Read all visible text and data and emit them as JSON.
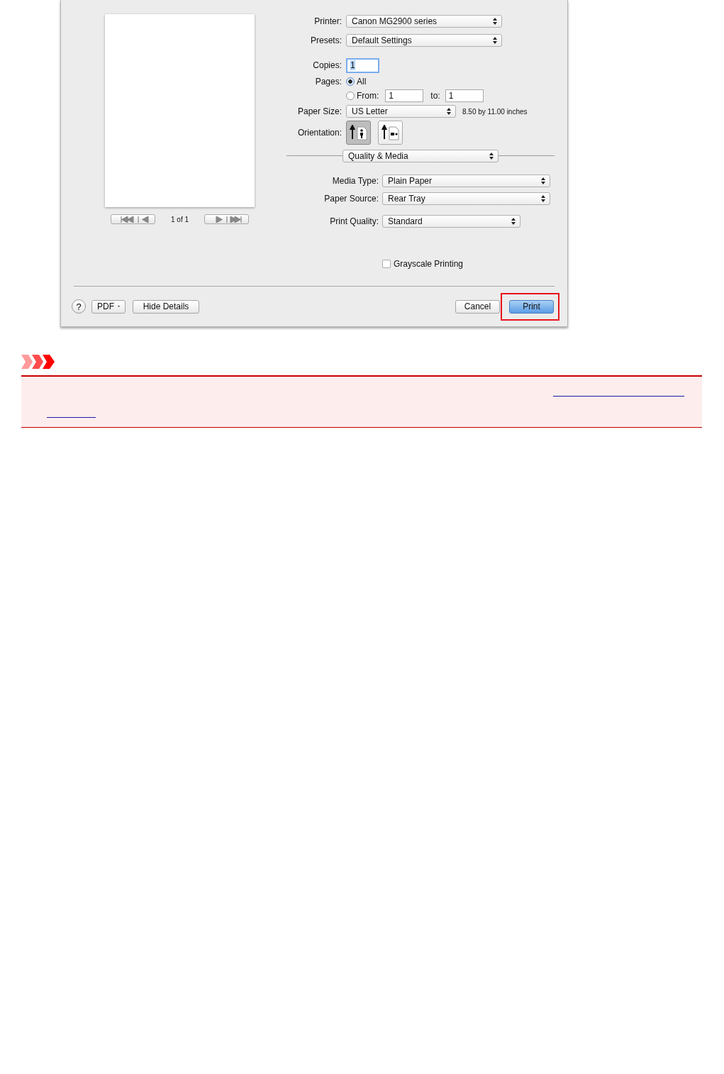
{
  "preview": {
    "page_indicator": "1 of 1"
  },
  "printer": {
    "label": "Printer:",
    "value": "Canon MG2900 series"
  },
  "presets": {
    "label": "Presets:",
    "value": "Default Settings"
  },
  "copies": {
    "label": "Copies:",
    "value": "1"
  },
  "pages": {
    "label": "Pages:",
    "options": [
      {
        "label": "All",
        "selected": true
      },
      {
        "label": "From:",
        "selected": false
      }
    ],
    "from": "1",
    "to_label": "to:",
    "to": "1"
  },
  "paper_size": {
    "label": "Paper Size:",
    "value": "US Letter",
    "note": "8.50 by 11.00 inches"
  },
  "orientation": {
    "label": "Orientation:",
    "options": [
      {
        "kind": "portrait",
        "selected": true
      },
      {
        "kind": "landscape",
        "selected": false
      }
    ]
  },
  "panel": {
    "value": "Quality & Media"
  },
  "media_type": {
    "label": "Media Type:",
    "value": "Plain Paper"
  },
  "paper_source": {
    "label": "Paper Source:",
    "value": "Rear Tray"
  },
  "print_quality": {
    "label": "Print Quality:",
    "value": "Standard"
  },
  "grayscale": {
    "label": "Grayscale Printing",
    "checked": false
  },
  "footer": {
    "help": "?",
    "pdf": "PDF",
    "hide_details": "Hide Details",
    "cancel": "Cancel",
    "print": "Print",
    "print_highlighted": true
  }
}
